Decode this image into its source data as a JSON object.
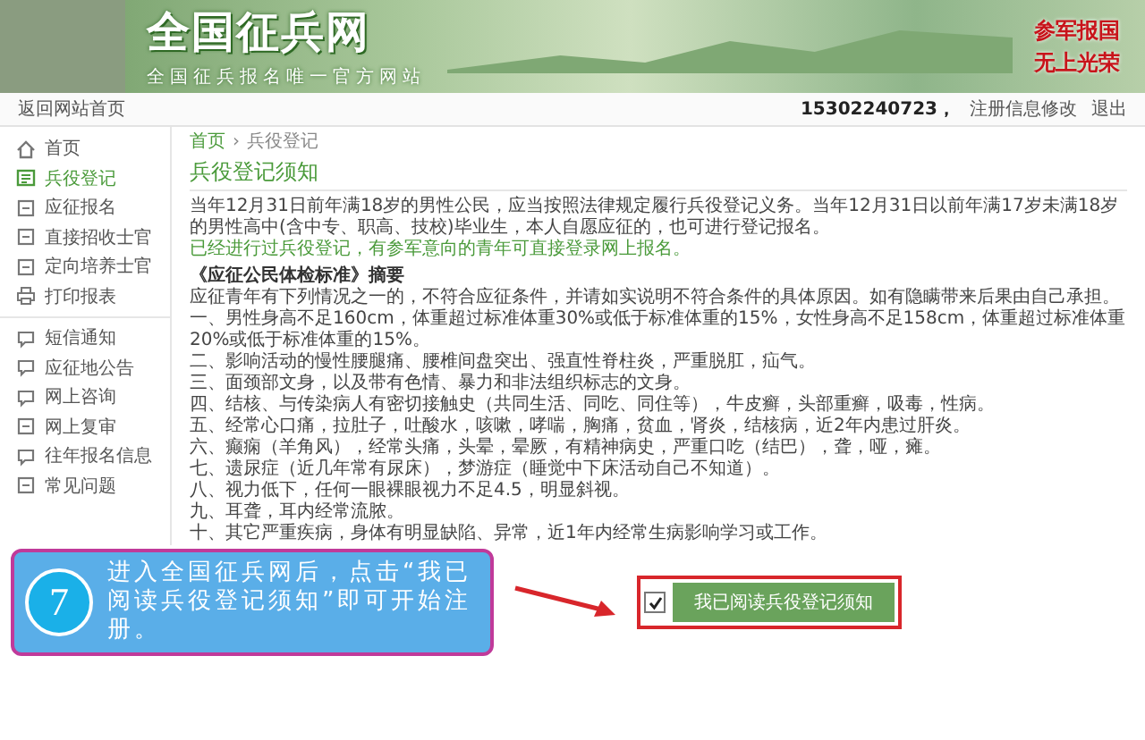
{
  "header": {
    "logo": "全国征兵网",
    "subtitle": "全国征兵报名唯一官方网站",
    "slogan": [
      "参军报国",
      "无上光荣"
    ]
  },
  "nav": {
    "home_link": "返回网站首页",
    "user": "15302240723，",
    "edit_link": "注册信息修改",
    "logout": "退出"
  },
  "sidebar": {
    "groups": [
      [
        {
          "label": "首页",
          "kind": "home",
          "selected": false
        },
        {
          "label": "兵役登记",
          "kind": "register",
          "selected": true
        },
        {
          "label": "应征报名",
          "kind": "form",
          "selected": false
        },
        {
          "label": "直接招收士官",
          "kind": "form",
          "selected": false
        },
        {
          "label": "定向培养士官",
          "kind": "form",
          "selected": false
        },
        {
          "label": "打印报表",
          "kind": "print",
          "selected": false
        }
      ],
      [
        {
          "label": "短信通知",
          "kind": "message",
          "selected": false
        },
        {
          "label": "应征地公告",
          "kind": "message",
          "selected": false
        },
        {
          "label": "网上咨询",
          "kind": "message",
          "selected": false
        },
        {
          "label": "网上复审",
          "kind": "form",
          "selected": false
        },
        {
          "label": "往年报名信息",
          "kind": "message",
          "selected": false
        },
        {
          "label": "常见问题",
          "kind": "form",
          "selected": false
        }
      ]
    ]
  },
  "breadcrumb": [
    "首页",
    "›",
    "兵役登记"
  ],
  "title": "兵役登记须知",
  "intro": "当年12月31日前年满18岁的男性公民，应当按照法律规定履行兵役登记义务。当年12月31日以前年满17岁未满18岁的男性高中(含中专、职高、技校)毕业生，本人自愿应征的，也可进行登记报名。",
  "notice": "已经进行过兵役登记，有参军意向的青年可直接登录网上报名。",
  "standard": {
    "heading": "《应征公民体检标准》摘要",
    "lead": "应征青年有下列情况之一的，不符合应征条件，并请如实说明不符合条件的具体原因。如有隐瞒带来后果由自己承担。",
    "items": [
      "一、男性身高不足160cm，体重超过标准体重30%或低于标准体重的15%，女性身高不足158cm，体重超过标准体重20%或低于标准体重的15%。",
      "二、影响活动的慢性腰腿痛、腰椎间盘突出、强直性脊柱炎，严重脱肛，疝气。",
      "三、面颈部文身，以及带有色情、暴力和非法组织标志的文身。",
      "四、结核、与传染病人有密切接触史（共同生活、同吃、同住等），牛皮癣，头部重癣，吸毒，性病。",
      "五、经常心口痛，拉肚子，吐酸水，咳嗽，哮喘，胸痛，贫血，肾炎，结核病，近2年内患过肝炎。",
      "六、癫痫（羊角风），经常头痛，头晕，晕厥，有精神病史，严重口吃（结巴），聋，哑，瘫。",
      "七、遗尿症（近几年常有尿床），梦游症（睡觉中下床活动自己不知道）。",
      "八、视力低下，任何一眼裸眼视力不足4.5，明显斜视。",
      "九、耳聋，耳内经常流脓。",
      "十、其它严重疾病，身体有明显缺陷、异常，近1年内经常生病影响学习或工作。"
    ]
  },
  "agree": {
    "checked": true,
    "button": "我已阅读兵役登记须知"
  },
  "callout": {
    "step": "7",
    "text": "进入全国征兵网后，点击“我已阅读兵役登记须知”即可开始注册。"
  }
}
